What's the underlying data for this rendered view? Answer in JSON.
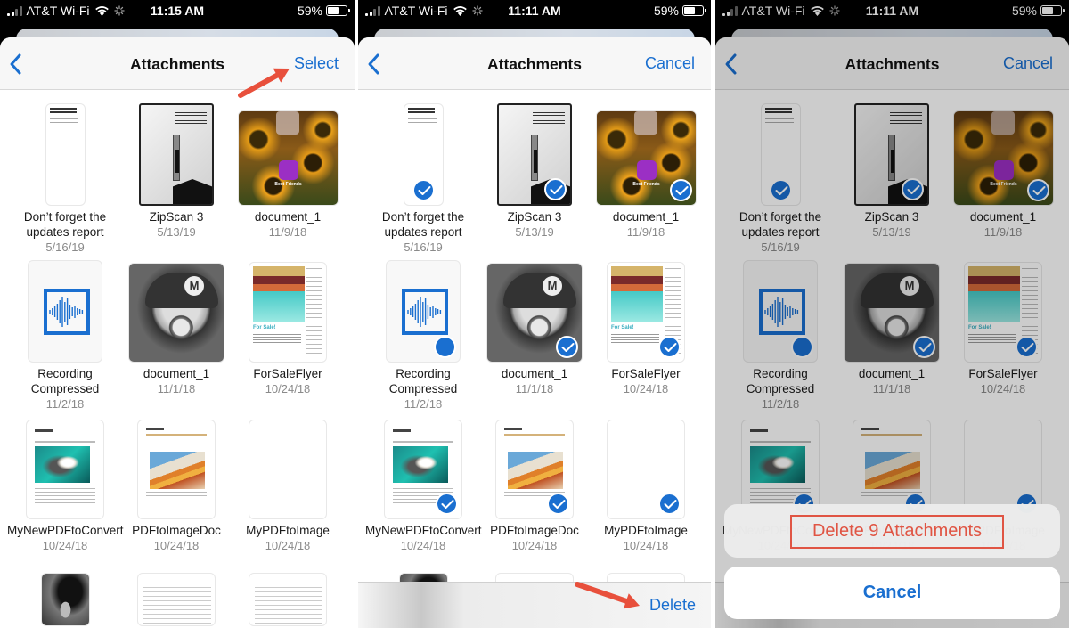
{
  "colors": {
    "accent": "#1a6fd0",
    "destructive": "#e05544",
    "annotation": "#e8503c"
  },
  "panels": [
    {
      "status": {
        "carrier": "AT&T Wi-Fi",
        "time": "11:15 AM",
        "battery": "59%",
        "battery_level": 0.59
      },
      "nav": {
        "title": "Attachments",
        "action": "Select"
      },
      "mode": "browse"
    },
    {
      "status": {
        "carrier": "AT&T Wi-Fi",
        "time": "11:11 AM",
        "battery": "59%",
        "battery_level": 0.59
      },
      "nav": {
        "title": "Attachments",
        "action": "Cancel"
      },
      "mode": "select",
      "toolbar": {
        "delete": "Delete"
      }
    },
    {
      "status": {
        "carrier": "AT&T Wi-Fi",
        "time": "11:11 AM",
        "battery": "59%",
        "battery_level": 0.59
      },
      "nav": {
        "title": "Attachments",
        "action": "Cancel"
      },
      "mode": "confirm",
      "action_sheet": {
        "delete": "Delete 9 Attachments",
        "cancel": "Cancel"
      }
    }
  ],
  "attachments": [
    {
      "name": "Don’t forget the updates report",
      "date": "5/16/19",
      "kind": "note",
      "selected": true
    },
    {
      "name": "ZipScan 3",
      "date": "5/13/19",
      "kind": "scan",
      "selected": true
    },
    {
      "name": "document_1",
      "date": "11/9/18",
      "kind": "photo-sunflowers",
      "selected": true
    },
    {
      "name": "Recording Compressed",
      "date": "11/2/18",
      "kind": "audio",
      "selected": true
    },
    {
      "name": "document_1",
      "date": "11/1/18",
      "kind": "photo-mario",
      "selected": true
    },
    {
      "name": "ForSaleFlyer",
      "date": "10/24/18",
      "kind": "flyer",
      "selected": true
    },
    {
      "name": "MyNewPDFtoConvert",
      "date": "10/24/18",
      "kind": "pdf-otter",
      "selected": true
    },
    {
      "name": "PDFtoImageDoc",
      "date": "10/24/18",
      "kind": "pdf-beach",
      "selected": true
    },
    {
      "name": "MyPDFtoImage",
      "date": "10/24/18",
      "kind": "blank",
      "selected": true
    },
    {
      "name": "",
      "date": "",
      "kind": "photo-mario-2",
      "selected": false
    },
    {
      "name": "",
      "date": "",
      "kind": "invoice",
      "selected": false
    },
    {
      "name": "",
      "date": "",
      "kind": "invoice-2",
      "selected": false
    }
  ],
  "thumb_text": {
    "note_title": "Don't forget the updates report",
    "flyer_heading": "For Sale!",
    "app_label": "Best Friends",
    "mario_cap": "M"
  }
}
